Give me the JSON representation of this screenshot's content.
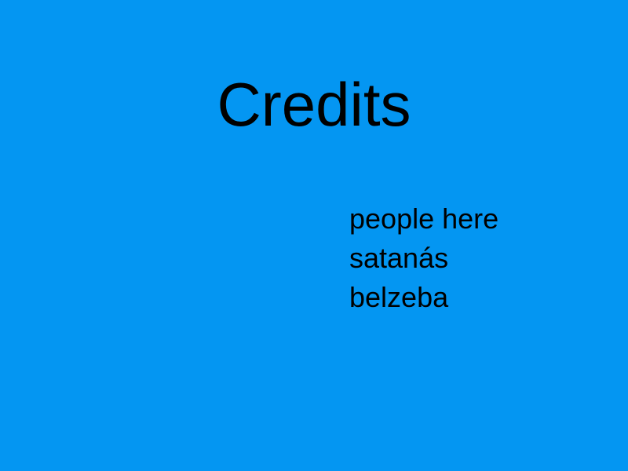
{
  "title": "Credits",
  "credits": [
    "people here",
    "satanás",
    "belzeba"
  ],
  "colors": {
    "background": "#0496f2",
    "text": "#000000"
  }
}
